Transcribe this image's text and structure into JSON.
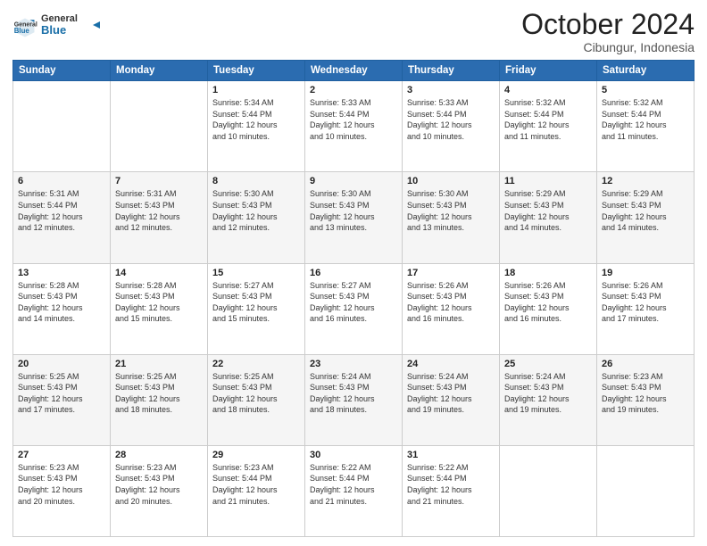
{
  "logo": {
    "general": "General",
    "blue": "Blue"
  },
  "header": {
    "month": "October 2024",
    "location": "Cibungur, Indonesia"
  },
  "weekdays": [
    "Sunday",
    "Monday",
    "Tuesday",
    "Wednesday",
    "Thursday",
    "Friday",
    "Saturday"
  ],
  "weeks": [
    [
      {
        "day": "",
        "info": ""
      },
      {
        "day": "",
        "info": ""
      },
      {
        "day": "1",
        "info": "Sunrise: 5:34 AM\nSunset: 5:44 PM\nDaylight: 12 hours\nand 10 minutes."
      },
      {
        "day": "2",
        "info": "Sunrise: 5:33 AM\nSunset: 5:44 PM\nDaylight: 12 hours\nand 10 minutes."
      },
      {
        "day": "3",
        "info": "Sunrise: 5:33 AM\nSunset: 5:44 PM\nDaylight: 12 hours\nand 10 minutes."
      },
      {
        "day": "4",
        "info": "Sunrise: 5:32 AM\nSunset: 5:44 PM\nDaylight: 12 hours\nand 11 minutes."
      },
      {
        "day": "5",
        "info": "Sunrise: 5:32 AM\nSunset: 5:44 PM\nDaylight: 12 hours\nand 11 minutes."
      }
    ],
    [
      {
        "day": "6",
        "info": "Sunrise: 5:31 AM\nSunset: 5:44 PM\nDaylight: 12 hours\nand 12 minutes."
      },
      {
        "day": "7",
        "info": "Sunrise: 5:31 AM\nSunset: 5:43 PM\nDaylight: 12 hours\nand 12 minutes."
      },
      {
        "day": "8",
        "info": "Sunrise: 5:30 AM\nSunset: 5:43 PM\nDaylight: 12 hours\nand 12 minutes."
      },
      {
        "day": "9",
        "info": "Sunrise: 5:30 AM\nSunset: 5:43 PM\nDaylight: 12 hours\nand 13 minutes."
      },
      {
        "day": "10",
        "info": "Sunrise: 5:30 AM\nSunset: 5:43 PM\nDaylight: 12 hours\nand 13 minutes."
      },
      {
        "day": "11",
        "info": "Sunrise: 5:29 AM\nSunset: 5:43 PM\nDaylight: 12 hours\nand 14 minutes."
      },
      {
        "day": "12",
        "info": "Sunrise: 5:29 AM\nSunset: 5:43 PM\nDaylight: 12 hours\nand 14 minutes."
      }
    ],
    [
      {
        "day": "13",
        "info": "Sunrise: 5:28 AM\nSunset: 5:43 PM\nDaylight: 12 hours\nand 14 minutes."
      },
      {
        "day": "14",
        "info": "Sunrise: 5:28 AM\nSunset: 5:43 PM\nDaylight: 12 hours\nand 15 minutes."
      },
      {
        "day": "15",
        "info": "Sunrise: 5:27 AM\nSunset: 5:43 PM\nDaylight: 12 hours\nand 15 minutes."
      },
      {
        "day": "16",
        "info": "Sunrise: 5:27 AM\nSunset: 5:43 PM\nDaylight: 12 hours\nand 16 minutes."
      },
      {
        "day": "17",
        "info": "Sunrise: 5:26 AM\nSunset: 5:43 PM\nDaylight: 12 hours\nand 16 minutes."
      },
      {
        "day": "18",
        "info": "Sunrise: 5:26 AM\nSunset: 5:43 PM\nDaylight: 12 hours\nand 16 minutes."
      },
      {
        "day": "19",
        "info": "Sunrise: 5:26 AM\nSunset: 5:43 PM\nDaylight: 12 hours\nand 17 minutes."
      }
    ],
    [
      {
        "day": "20",
        "info": "Sunrise: 5:25 AM\nSunset: 5:43 PM\nDaylight: 12 hours\nand 17 minutes."
      },
      {
        "day": "21",
        "info": "Sunrise: 5:25 AM\nSunset: 5:43 PM\nDaylight: 12 hours\nand 18 minutes."
      },
      {
        "day": "22",
        "info": "Sunrise: 5:25 AM\nSunset: 5:43 PM\nDaylight: 12 hours\nand 18 minutes."
      },
      {
        "day": "23",
        "info": "Sunrise: 5:24 AM\nSunset: 5:43 PM\nDaylight: 12 hours\nand 18 minutes."
      },
      {
        "day": "24",
        "info": "Sunrise: 5:24 AM\nSunset: 5:43 PM\nDaylight: 12 hours\nand 19 minutes."
      },
      {
        "day": "25",
        "info": "Sunrise: 5:24 AM\nSunset: 5:43 PM\nDaylight: 12 hours\nand 19 minutes."
      },
      {
        "day": "26",
        "info": "Sunrise: 5:23 AM\nSunset: 5:43 PM\nDaylight: 12 hours\nand 19 minutes."
      }
    ],
    [
      {
        "day": "27",
        "info": "Sunrise: 5:23 AM\nSunset: 5:43 PM\nDaylight: 12 hours\nand 20 minutes."
      },
      {
        "day": "28",
        "info": "Sunrise: 5:23 AM\nSunset: 5:43 PM\nDaylight: 12 hours\nand 20 minutes."
      },
      {
        "day": "29",
        "info": "Sunrise: 5:23 AM\nSunset: 5:44 PM\nDaylight: 12 hours\nand 21 minutes."
      },
      {
        "day": "30",
        "info": "Sunrise: 5:22 AM\nSunset: 5:44 PM\nDaylight: 12 hours\nand 21 minutes."
      },
      {
        "day": "31",
        "info": "Sunrise: 5:22 AM\nSunset: 5:44 PM\nDaylight: 12 hours\nand 21 minutes."
      },
      {
        "day": "",
        "info": ""
      },
      {
        "day": "",
        "info": ""
      }
    ]
  ]
}
